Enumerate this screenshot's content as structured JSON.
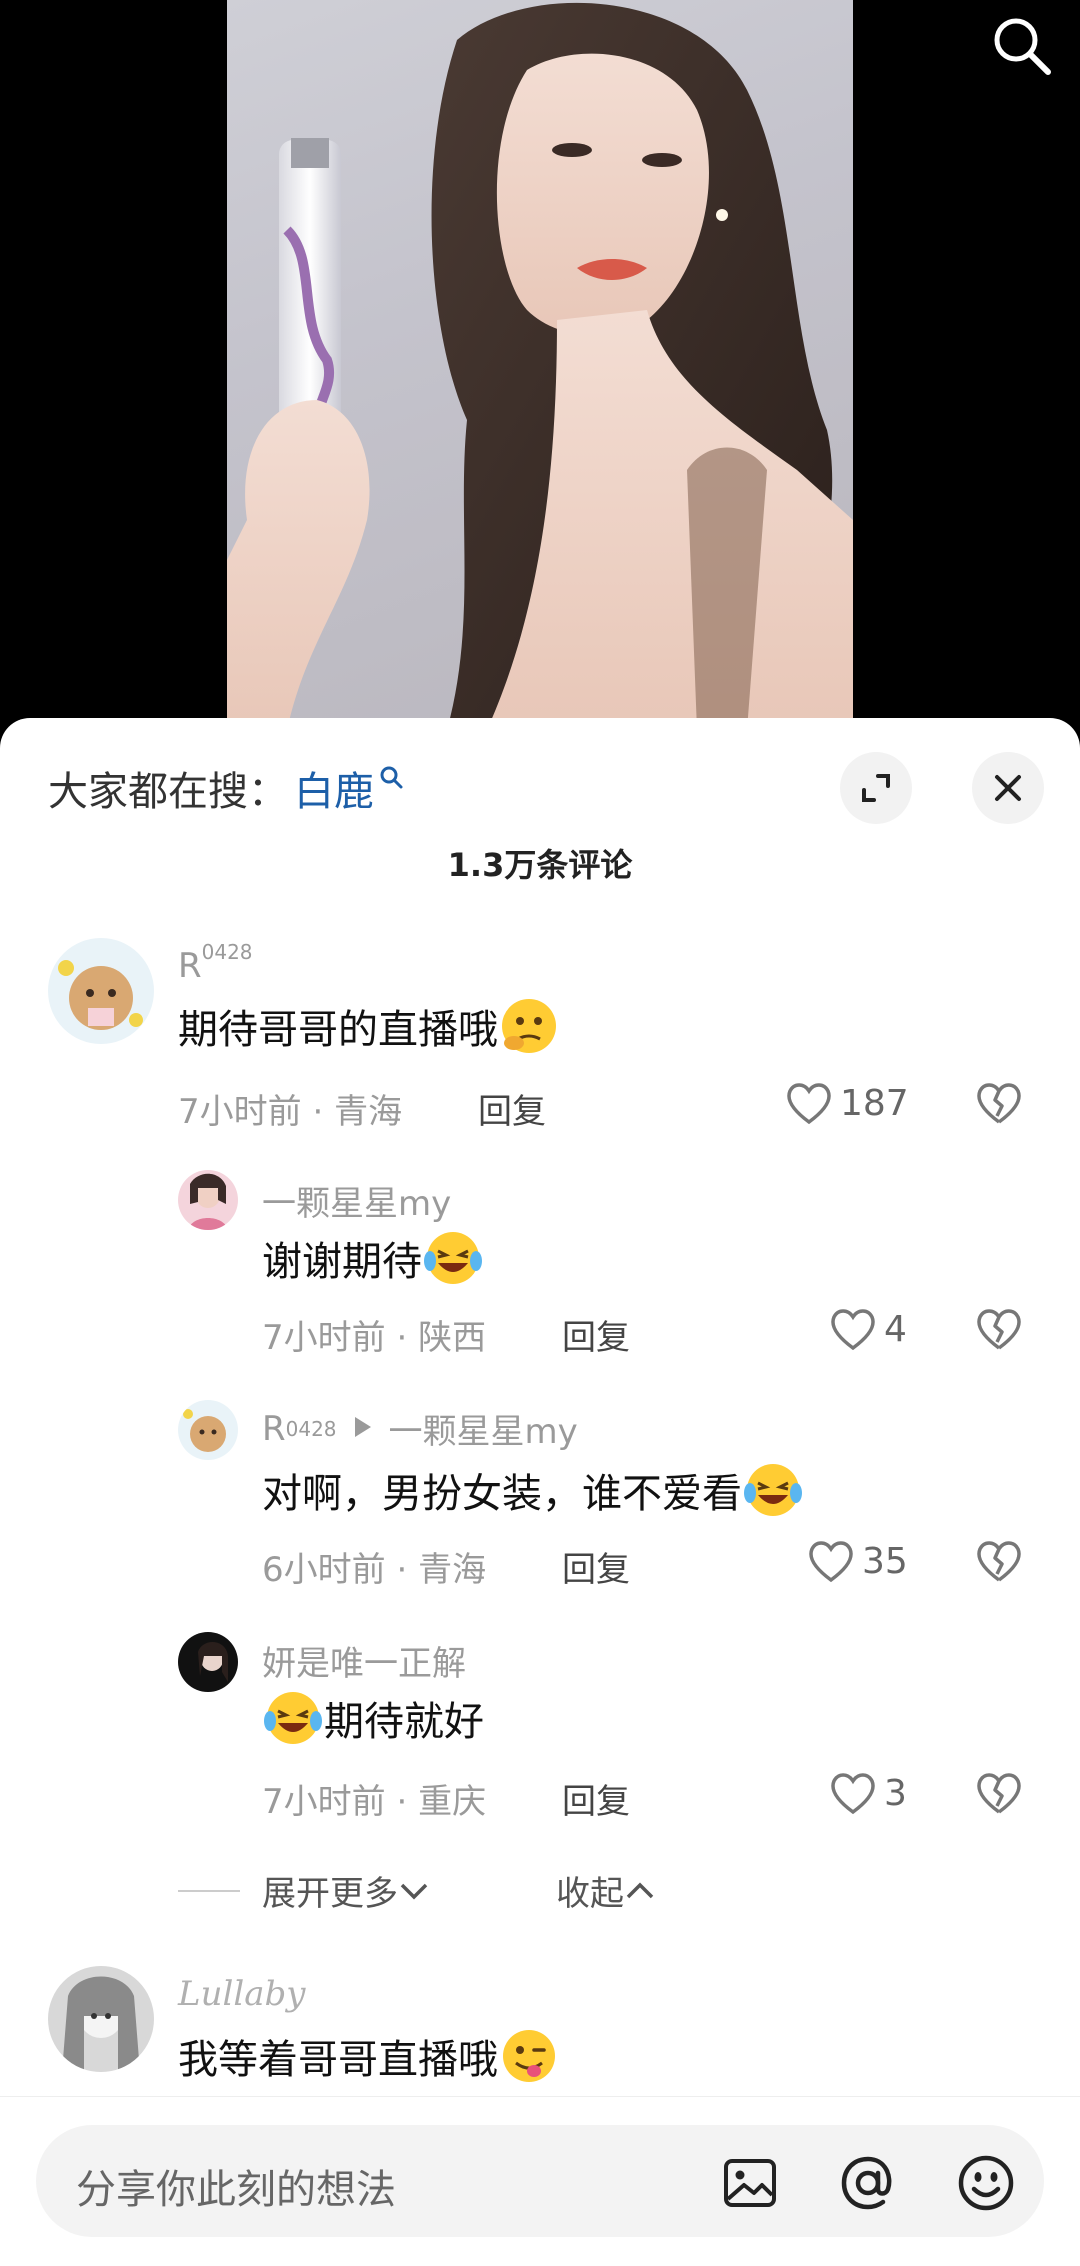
{
  "trending": {
    "prefix": "大家都在搜：",
    "keyword": "白鹿"
  },
  "comments_header": {
    "count_label": "1.3万条评论"
  },
  "comments": [
    {
      "user": "R",
      "user_sup": "0428",
      "text": "期待哥哥的直播哦",
      "emoji": "thinking-face",
      "time": "7小时前",
      "location": "青海",
      "reply_label": "回复",
      "likes": "187"
    },
    {
      "user": "一颗星星my",
      "text": "谢谢期待",
      "emoji": "laughing-tears",
      "time": "7小时前",
      "location": "陕西",
      "reply_label": "回复",
      "likes": "4"
    },
    {
      "user": "R",
      "user_sup": "0428",
      "reply_to": "一颗星星my",
      "text": "对啊，男扮女装，谁不爱看",
      "emoji": "laughing-tears",
      "time": "6小时前",
      "location": "青海",
      "reply_label": "回复",
      "likes": "35"
    },
    {
      "user": "妍是唯一正解",
      "text": "期待就好",
      "emoji": "laughing-tears",
      "time": "7小时前",
      "location": "重庆",
      "reply_label": "回复",
      "likes": "3"
    },
    {
      "user": "Lullaby",
      "text": "我等着哥哥直播哦",
      "emoji": "winking-tongue"
    }
  ],
  "thread_controls": {
    "expand_more": "展开更多",
    "collapse": "收起"
  },
  "input": {
    "placeholder": "分享你此刻的想法"
  },
  "icons": {
    "top_right": "search-icon",
    "sheet_expand": "expand-icon",
    "sheet_close": "close-icon",
    "like": "heart-icon",
    "dislike": "broken-heart-icon",
    "input_tools": [
      "image-icon",
      "at-icon",
      "emoji-icon"
    ]
  },
  "colors": {
    "keyword_blue": "#1d5fa8",
    "meta_gray": "#9a9a9a",
    "sheet_bg": "#ffffff",
    "input_bg": "#f3f3f3"
  }
}
